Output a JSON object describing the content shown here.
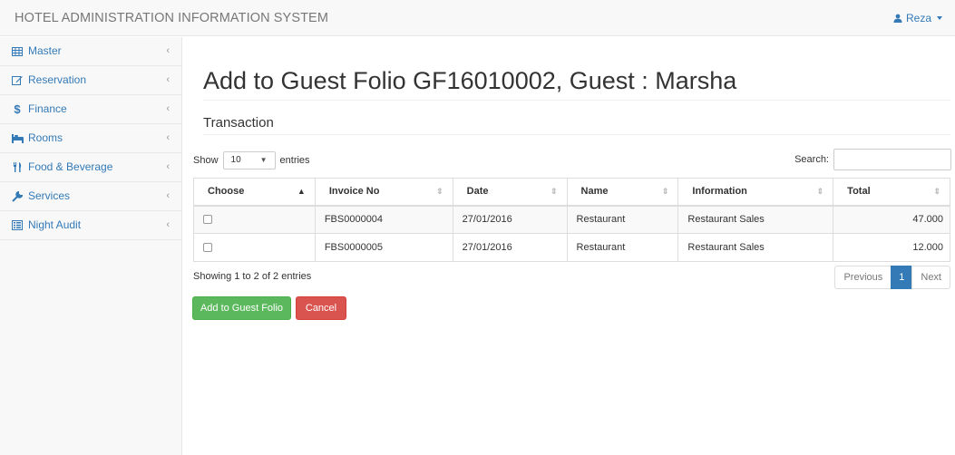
{
  "app": {
    "title": "HOTEL ADMINISTRATION INFORMATION SYSTEM",
    "user": "Reza"
  },
  "sidebar": {
    "items": [
      {
        "label": "Master",
        "icon": "table-icon"
      },
      {
        "label": "Reservation",
        "icon": "edit-icon"
      },
      {
        "label": "Finance",
        "icon": "dollar-icon"
      },
      {
        "label": "Rooms",
        "icon": "bed-icon"
      },
      {
        "label": "Food & Beverage",
        "icon": "cutlery-icon"
      },
      {
        "label": "Services",
        "icon": "wrench-icon"
      },
      {
        "label": "Night Audit",
        "icon": "list-icon"
      }
    ],
    "chevron": "‹"
  },
  "page": {
    "title": "Add to Guest Folio GF16010002, Guest : Marsha",
    "section": "Transaction"
  },
  "table_controls": {
    "show_label": "Show",
    "entries_value": "10",
    "entries_label": "entries",
    "search_label": "Search:",
    "search_value": ""
  },
  "table": {
    "columns": [
      "Choose",
      "Invoice No",
      "Date",
      "Name",
      "Information",
      "Total"
    ],
    "rows": [
      {
        "invoice": "FBS0000004",
        "date": "27/01/2016",
        "name": "Restaurant",
        "information": "Restaurant Sales",
        "total": "47.000",
        "checked": false
      },
      {
        "invoice": "FBS0000005",
        "date": "27/01/2016",
        "name": "Restaurant",
        "information": "Restaurant Sales",
        "total": "12.000",
        "checked": false
      }
    ]
  },
  "footer": {
    "info": "Showing 1 to 2 of 2 entries",
    "prev": "Previous",
    "page": "1",
    "next": "Next"
  },
  "buttons": {
    "add": "Add to Guest Folio",
    "cancel": "Cancel"
  },
  "colors": {
    "link": "#337ab7",
    "success": "#5cb85c",
    "danger": "#d9534f"
  }
}
